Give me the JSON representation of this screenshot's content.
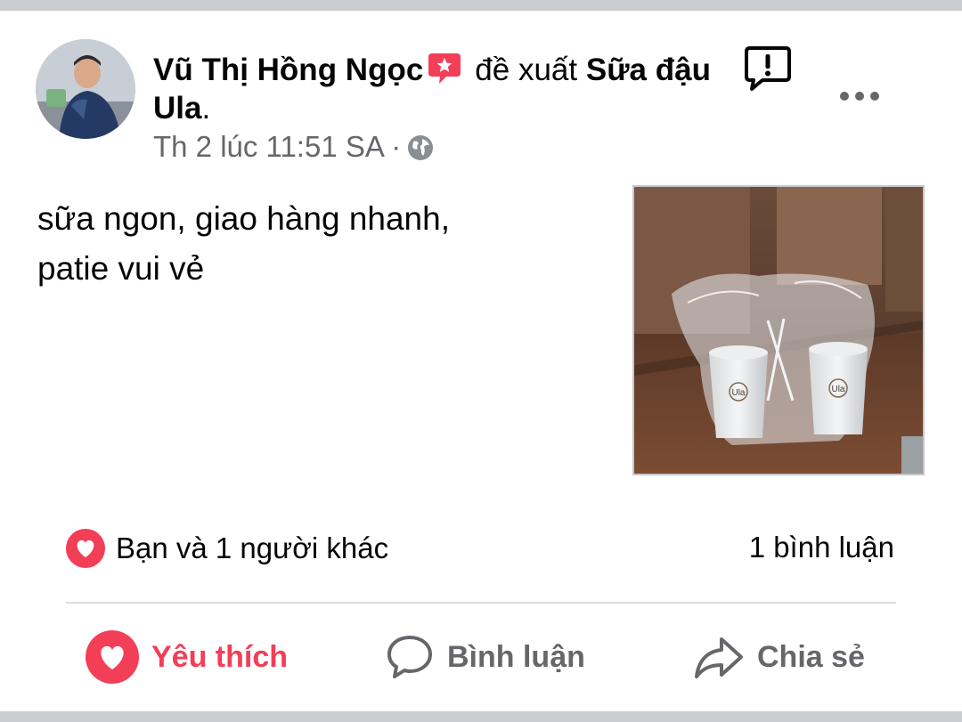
{
  "post": {
    "author": "Vũ Thị Hồng Ngọc",
    "action": "đề xuất",
    "page_name_part1": "Sữa đậu",
    "page_name_part2": "Ula",
    "page_name_suffix": ".",
    "timestamp": "Th 2 lúc 11:51 SA",
    "separator": "·",
    "text_line1": "sữa ngon, giao hàng nhanh,",
    "text_line2": "patie vui vẻ"
  },
  "stats": {
    "reactions": "Bạn và 1 người khác",
    "comments": "1 bình luận"
  },
  "actions": {
    "like": "Yêu thích",
    "comment": "Bình luận",
    "share": "Chia sẻ"
  },
  "photo": {
    "cup_logo": "Ula"
  },
  "colors": {
    "recommend_badge": "#f33e58",
    "love": "#f33e58",
    "secondary_text": "#65676b",
    "primary_text": "#050505"
  },
  "icons": {
    "badge": "recommend-badge-icon",
    "privacy": "globe-icon",
    "report": "report-icon",
    "more": "more-icon",
    "reaction": "love-reaction-icon",
    "like": "heart-icon",
    "comment": "comment-icon",
    "share": "share-icon"
  }
}
